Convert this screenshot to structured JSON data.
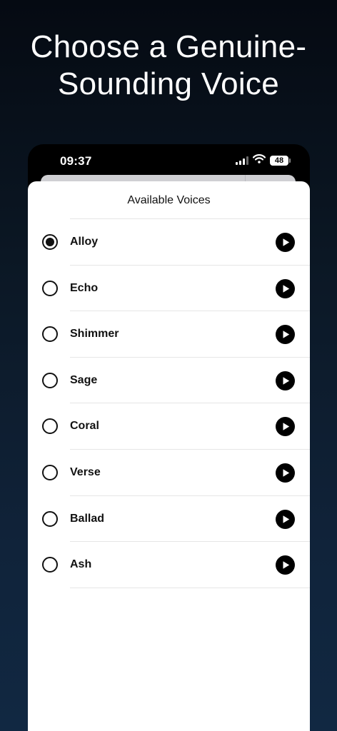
{
  "headline": {
    "line1": "Choose a Genuine-",
    "line2": "Sounding Voice"
  },
  "status_bar": {
    "time": "09:37",
    "battery": "48"
  },
  "sheet": {
    "title": "Available Voices"
  },
  "voices": [
    {
      "name": "Alloy",
      "selected": true
    },
    {
      "name": "Echo",
      "selected": false
    },
    {
      "name": "Shimmer",
      "selected": false
    },
    {
      "name": "Sage",
      "selected": false
    },
    {
      "name": "Coral",
      "selected": false
    },
    {
      "name": "Verse",
      "selected": false
    },
    {
      "name": "Ballad",
      "selected": false
    },
    {
      "name": "Ash",
      "selected": false
    }
  ],
  "icons": {
    "play": "play-icon",
    "wifi": "wifi-icon",
    "signal": "cellular-signal-icon",
    "battery": "battery-icon"
  }
}
